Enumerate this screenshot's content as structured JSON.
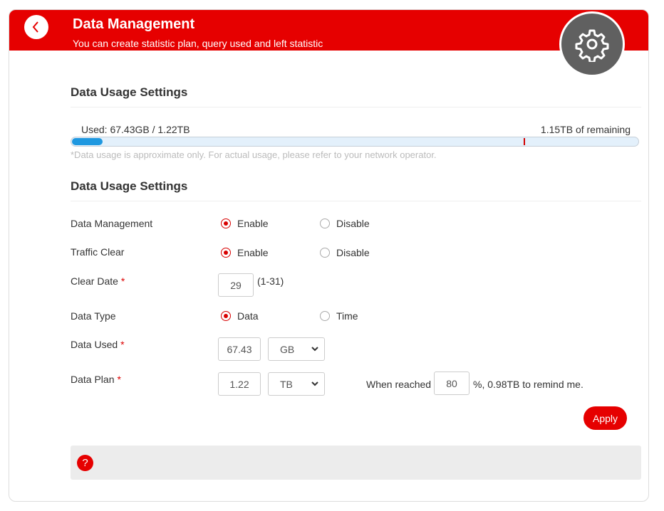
{
  "header": {
    "title": "Data Management",
    "subtitle": "You can create statistic plan, query used and left statistic",
    "back_icon": "chevron-left-icon",
    "hero_icon": "gear-icon"
  },
  "usage": {
    "section_title": "Data Usage Settings",
    "used_text": "Used: 67.43GB / 1.22TB",
    "remaining_text": "1.15TB of remaining",
    "used_fraction": 0.054,
    "reminder_fraction": 0.8,
    "note": "*Data usage is approximate only. For actual usage, please refer to your network operator."
  },
  "settings": {
    "section_title": "Data Usage Settings",
    "data_management": {
      "label": "Data Management",
      "options": [
        "Enable",
        "Disable"
      ],
      "selected": "Enable"
    },
    "traffic_clear": {
      "label": "Traffic Clear",
      "options": [
        "Enable",
        "Disable"
      ],
      "selected": "Enable"
    },
    "clear_date": {
      "label": "Clear Date",
      "required": "*",
      "value": "29",
      "hint": "(1-31)"
    },
    "data_type": {
      "label": "Data Type",
      "options": [
        "Data",
        "Time"
      ],
      "selected": "Data"
    },
    "data_used": {
      "label": "Data Used",
      "required": "*",
      "value": "67.43",
      "unit": "GB"
    },
    "data_plan": {
      "label": "Data Plan",
      "required": "*",
      "value": "1.22",
      "unit": "TB"
    },
    "reminder": {
      "prefix": "When reached",
      "value": "80",
      "suffix": "%, 0.98TB to remind me."
    },
    "apply_label": "Apply"
  },
  "help": {
    "icon_glyph": "?"
  },
  "colors": {
    "brand": "#e60000",
    "progress": "#1f98e0"
  }
}
